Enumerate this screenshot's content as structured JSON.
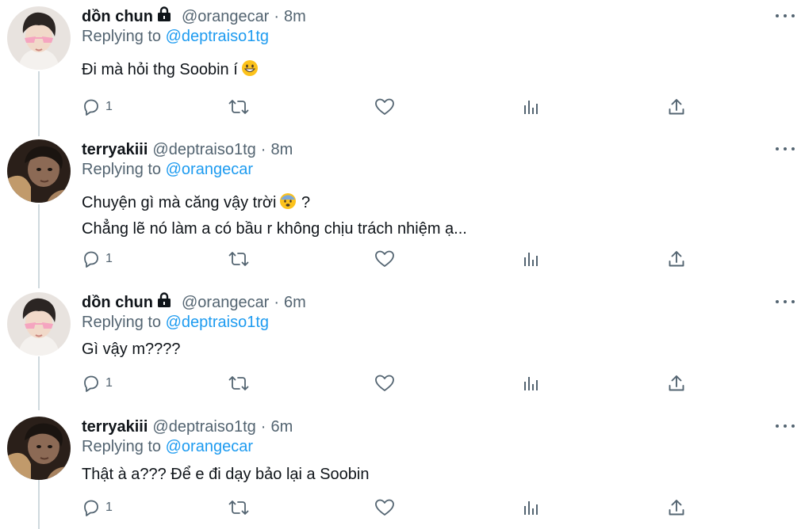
{
  "tweets": [
    {
      "name": "dồn chun",
      "locked": true,
      "handle": "@orangecar",
      "dot": "·",
      "time": "8m",
      "replying_prefix": "Replying to",
      "replying_to": "@deptraiso1tg",
      "lines": [
        "Đi mà hỏi thg Soobin í"
      ],
      "emoji": "grinning-face-emoji",
      "reply_count": "1",
      "avatar": "avatar-pink-glasses"
    },
    {
      "name": "terryakiii",
      "locked": false,
      "handle": "@deptraiso1tg",
      "dot": "·",
      "time": "8m",
      "replying_prefix": "Replying to",
      "replying_to": "@orangecar",
      "lines": [
        "Chuyện gì mà căng vậy trời",
        "Chẳng lẽ nó làm a có bầu r không chịu trách nhiệm ạ..."
      ],
      "line1_suffix": "?",
      "emoji": "anxious-face-emoji",
      "reply_count": "1",
      "avatar": "avatar-dark"
    },
    {
      "name": "dồn chun",
      "locked": true,
      "handle": "@orangecar",
      "dot": "·",
      "time": "6m",
      "replying_prefix": "Replying to",
      "replying_to": "@deptraiso1tg",
      "lines": [
        "Gì vậy m????"
      ],
      "reply_count": "1",
      "avatar": "avatar-pink-glasses"
    },
    {
      "name": "terryakiii",
      "locked": false,
      "handle": "@deptraiso1tg",
      "dot": "·",
      "time": "6m",
      "replying_prefix": "Replying to",
      "replying_to": "@orangecar",
      "lines": [
        "Thật à a??? Để e đi dạy bảo lại a Soobin"
      ],
      "reply_count": "1",
      "avatar": "avatar-dark"
    }
  ],
  "colors": {
    "text": "#0f1419",
    "muted": "#536471",
    "link": "#1d9bf0",
    "thread_line": "#cfd9de"
  }
}
